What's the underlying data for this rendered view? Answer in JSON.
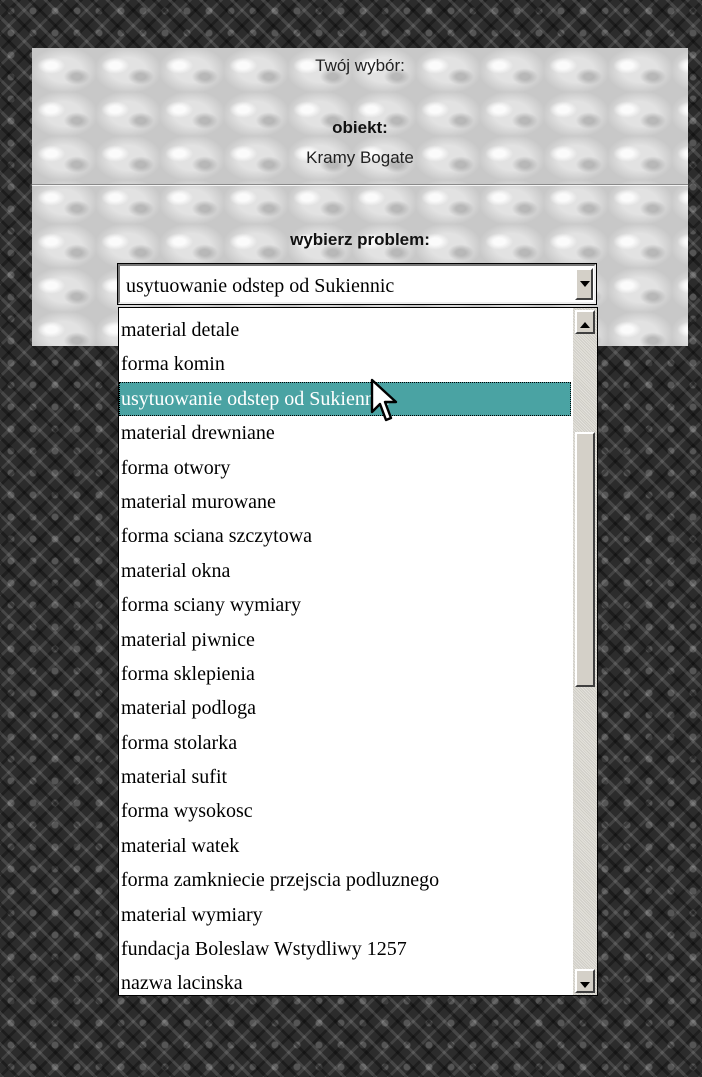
{
  "panel": {
    "choice_label": "Twój wybór:",
    "object_label": "obiekt:",
    "object_value": "Kramy Bogate",
    "problem_label": "wybierz problem:"
  },
  "select": {
    "value": "usytuowanie odstep od Sukiennic",
    "options": [
      "material detale",
      "forma komin",
      "usytuowanie odstep od Sukiennic",
      "material drewniane",
      "forma otwory",
      "material murowane",
      "forma sciana szczytowa",
      "material okna",
      "forma sciany wymiary",
      "material piwnice",
      "forma sklepienia",
      "material podloga",
      "forma stolarka",
      "material sufit",
      "forma wysokosc",
      "material watek",
      "forma zamkniecie przejscia podluznego",
      "material wymiary",
      "fundacja Boleslaw Wstydliwy 1257",
      "nazwa lacinska"
    ],
    "selected_index": 2
  },
  "colors": {
    "highlight": "#4aa3a3",
    "panel_bg": "#d6d6d6"
  }
}
